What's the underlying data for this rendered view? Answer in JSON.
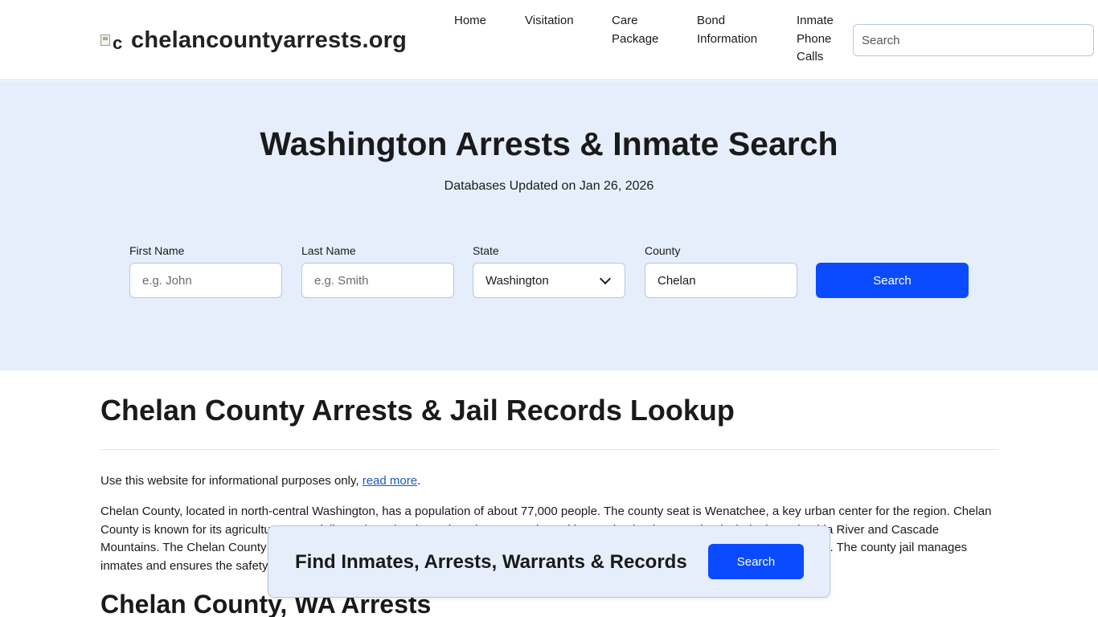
{
  "header": {
    "logo_alt": "c",
    "site_name": "chelancountyarrests.org",
    "nav": [
      {
        "lines": [
          "Home"
        ]
      },
      {
        "lines": [
          "Visitation"
        ]
      },
      {
        "lines": [
          "Care",
          "Package"
        ]
      },
      {
        "lines": [
          "Bond",
          "Information"
        ]
      },
      {
        "lines": [
          "Inmate",
          "Phone",
          "Calls"
        ]
      }
    ],
    "search_placeholder": "Search"
  },
  "hero": {
    "title": "Washington Arrests & Inmate Search",
    "updated": "Databases Updated on Jan 26, 2026",
    "form": {
      "first_name_label": "First Name",
      "first_name_placeholder": "e.g. John",
      "last_name_label": "Last Name",
      "last_name_placeholder": "e.g. Smith",
      "state_label": "State",
      "state_value": "Washington",
      "county_label": "County",
      "county_value": "Chelan",
      "search_label": "Search"
    }
  },
  "content": {
    "title": "Chelan County Arrests & Jail Records Lookup",
    "disclaimer_prefix": "Use this website for informational purposes only, ",
    "disclaimer_link": "read more",
    "disclaimer_suffix": ".",
    "paragraph": "Chelan County, located in north-central Washington, has a population of about 77,000 people. The county seat is Wenatchee, a key urban center for the region. Chelan County is known for its agriculture, especially apple orchards, and outdoor recreation, with stunning landscapes that include the Columbia River and Cascade Mountains. The Chelan County Sheriff's Office provides law enforcement services, focusing on public safety and community engagement. The county jail manages inmates and ensures the safety and security of the facility.",
    "subtitle": "Chelan County, WA Arrests"
  },
  "banner": {
    "text": "Find Inmates, Arrests, Warrants & Records",
    "button": "Search"
  },
  "colors": {
    "accent": "#0a4bff",
    "hero_bg": "#e6eefc",
    "link": "#1a57c7"
  }
}
